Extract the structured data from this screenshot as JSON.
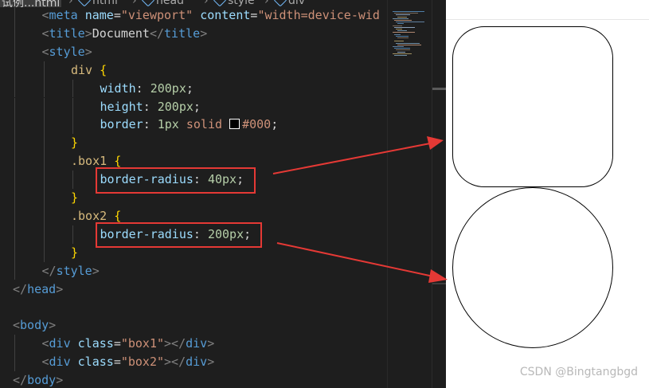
{
  "breadcrumb": {
    "file": "试例...html",
    "items": [
      "html",
      "head",
      "style",
      "div"
    ]
  },
  "code_lines": [
    {
      "indent": 1,
      "tokens": [
        [
          "punc",
          "<"
        ],
        [
          "tag",
          "meta"
        ],
        [
          "text",
          " "
        ],
        [
          "attr",
          "name"
        ],
        [
          "text",
          "="
        ],
        [
          "str",
          "\"viewport\""
        ],
        [
          "text",
          " "
        ],
        [
          "attr",
          "content"
        ],
        [
          "text",
          "="
        ],
        [
          "str",
          "\"width=device-wid"
        ]
      ]
    },
    {
      "indent": 1,
      "tokens": [
        [
          "punc",
          "<"
        ],
        [
          "tag",
          "title"
        ],
        [
          "punc",
          ">"
        ],
        [
          "text",
          "Document"
        ],
        [
          "punc",
          "</"
        ],
        [
          "tag",
          "title"
        ],
        [
          "punc",
          ">"
        ]
      ]
    },
    {
      "indent": 1,
      "tokens": [
        [
          "punc",
          "<"
        ],
        [
          "tag",
          "style"
        ],
        [
          "punc",
          ">"
        ]
      ]
    },
    {
      "indent": 2,
      "tokens": [
        [
          "sel",
          "div"
        ],
        [
          "text",
          " "
        ],
        [
          "brace",
          "{"
        ]
      ]
    },
    {
      "indent": 3,
      "tokens": [
        [
          "prop",
          "width"
        ],
        [
          "text",
          ": "
        ],
        [
          "num",
          "200px"
        ],
        [
          "text",
          ";"
        ]
      ]
    },
    {
      "indent": 3,
      "tokens": [
        [
          "prop",
          "height"
        ],
        [
          "text",
          ": "
        ],
        [
          "num",
          "200px"
        ],
        [
          "text",
          ";"
        ]
      ]
    },
    {
      "indent": 3,
      "tokens": [
        [
          "prop",
          "border"
        ],
        [
          "text",
          ": "
        ],
        [
          "num",
          "1px"
        ],
        [
          "text",
          " "
        ],
        [
          "val",
          "solid"
        ],
        [
          "text",
          " "
        ],
        [
          "swatch",
          ""
        ],
        [
          "val",
          "#000"
        ],
        [
          "text",
          ";"
        ]
      ]
    },
    {
      "indent": 2,
      "tokens": [
        [
          "brace",
          "}"
        ]
      ]
    },
    {
      "indent": 2,
      "tokens": [
        [
          "sel",
          ".box1"
        ],
        [
          "text",
          " "
        ],
        [
          "brace",
          "{"
        ]
      ]
    },
    {
      "indent": 3,
      "tokens": [
        [
          "prop",
          "border-radius"
        ],
        [
          "text",
          ": "
        ],
        [
          "num",
          "40px"
        ],
        [
          "text",
          ";"
        ]
      ]
    },
    {
      "indent": 2,
      "tokens": [
        [
          "brace",
          "}"
        ]
      ]
    },
    {
      "indent": 2,
      "tokens": [
        [
          "sel",
          ".box2"
        ],
        [
          "text",
          " "
        ],
        [
          "brace",
          "{"
        ]
      ]
    },
    {
      "indent": 3,
      "tokens": [
        [
          "prop",
          "border-radius"
        ],
        [
          "text",
          ": "
        ],
        [
          "num",
          "200px"
        ],
        [
          "text",
          ";"
        ]
      ]
    },
    {
      "indent": 2,
      "tokens": [
        [
          "brace",
          "}"
        ]
      ]
    },
    {
      "indent": 1,
      "tokens": [
        [
          "punc",
          "</"
        ],
        [
          "tag",
          "style"
        ],
        [
          "punc",
          ">"
        ]
      ]
    },
    {
      "indent": 0,
      "tokens": [
        [
          "punc",
          "</"
        ],
        [
          "tag",
          "head"
        ],
        [
          "punc",
          ">"
        ]
      ]
    },
    {
      "indent": 0,
      "tokens": []
    },
    {
      "indent": 0,
      "tokens": [
        [
          "punc",
          "<"
        ],
        [
          "tag",
          "body"
        ],
        [
          "punc",
          ">"
        ]
      ]
    },
    {
      "indent": 1,
      "tokens": [
        [
          "punc",
          "<"
        ],
        [
          "tag",
          "div"
        ],
        [
          "text",
          " "
        ],
        [
          "attr",
          "class"
        ],
        [
          "text",
          "="
        ],
        [
          "str",
          "\"box1\""
        ],
        [
          "punc",
          "></"
        ],
        [
          "tag",
          "div"
        ],
        [
          "punc",
          ">"
        ]
      ]
    },
    {
      "indent": 1,
      "tokens": [
        [
          "punc",
          "<"
        ],
        [
          "tag",
          "div"
        ],
        [
          "text",
          " "
        ],
        [
          "attr",
          "class"
        ],
        [
          "text",
          "="
        ],
        [
          "str",
          "\"box2\""
        ],
        [
          "punc",
          "></"
        ],
        [
          "tag",
          "div"
        ],
        [
          "punc",
          ">"
        ]
      ]
    },
    {
      "indent": 0,
      "tokens": [
        [
          "punc",
          "</"
        ],
        [
          "tag",
          "body"
        ],
        [
          "punc",
          ">"
        ]
      ]
    }
  ],
  "highlighted_lines": [
    9,
    12
  ],
  "colors": {
    "editor_bg": "#1e1e1e",
    "annotation_red": "#e53935"
  },
  "watermark": "CSDN @Bingtangbgd"
}
